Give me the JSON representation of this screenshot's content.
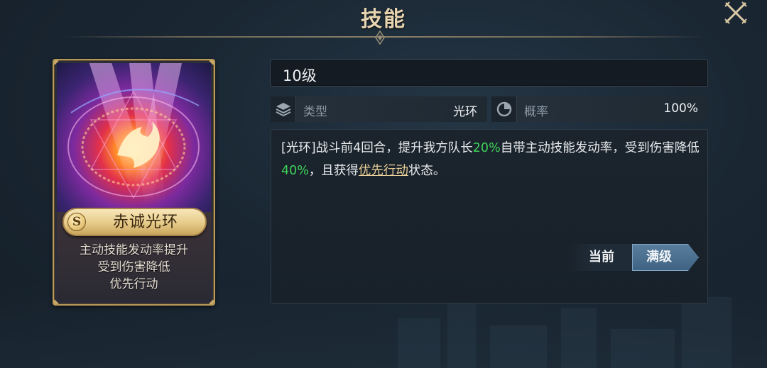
{
  "header": {
    "title": "技能"
  },
  "skill_card": {
    "grade": "S",
    "name": "赤诚光环",
    "effects": [
      "主动技能发动率提升",
      "受到伤害降低",
      "优先行动"
    ]
  },
  "level": {
    "label": "10级"
  },
  "info": {
    "type_label": "类型",
    "type_value": "光环",
    "rate_label": "概率",
    "rate_value": "100%"
  },
  "description": {
    "segments": [
      {
        "text": "[光环]战斗前4回合，提升我方队长",
        "style": "normal"
      },
      {
        "text": "20%",
        "style": "green"
      },
      {
        "text": "自带主动技能发动率，受到伤害降低",
        "style": "normal"
      },
      {
        "text": "40%",
        "style": "green"
      },
      {
        "text": "，且获得",
        "style": "normal"
      },
      {
        "text": "优先行动",
        "style": "link"
      },
      {
        "text": "状态。",
        "style": "normal"
      }
    ]
  },
  "toggle": {
    "current_label": "当前",
    "max_label": "满级"
  },
  "colors": {
    "highlight_green": "#3fd35a",
    "link_gold": "#ecd199",
    "frame_gold": "#b99a5a",
    "title_gold": "#e6d3b0"
  },
  "icons": {
    "close": "close-icon",
    "type": "layers-icon",
    "rate": "pie-chart-icon"
  }
}
